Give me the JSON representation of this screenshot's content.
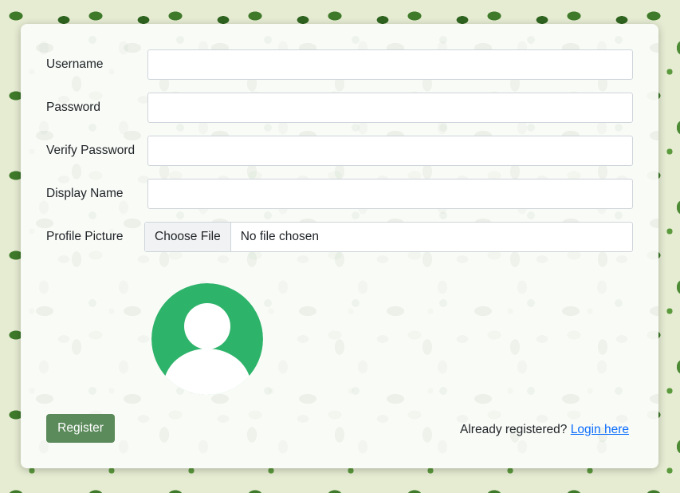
{
  "form": {
    "username_label": "Username",
    "username_value": "",
    "password_label": "Password",
    "password_value": "",
    "verify_password_label": "Verify Password",
    "verify_password_value": "",
    "display_name_label": "Display Name",
    "display_name_value": "",
    "profile_picture_label": "Profile Picture",
    "choose_file_label": "Choose File",
    "file_status": "No file chosen"
  },
  "avatar": {
    "icon": "user-avatar-icon",
    "color": "#2eb36a"
  },
  "actions": {
    "register_label": "Register",
    "already_registered_text": "Already registered? ",
    "login_link_text": "Login here",
    "button_color": "#5b8a5b",
    "link_color": "#0d6efd"
  }
}
